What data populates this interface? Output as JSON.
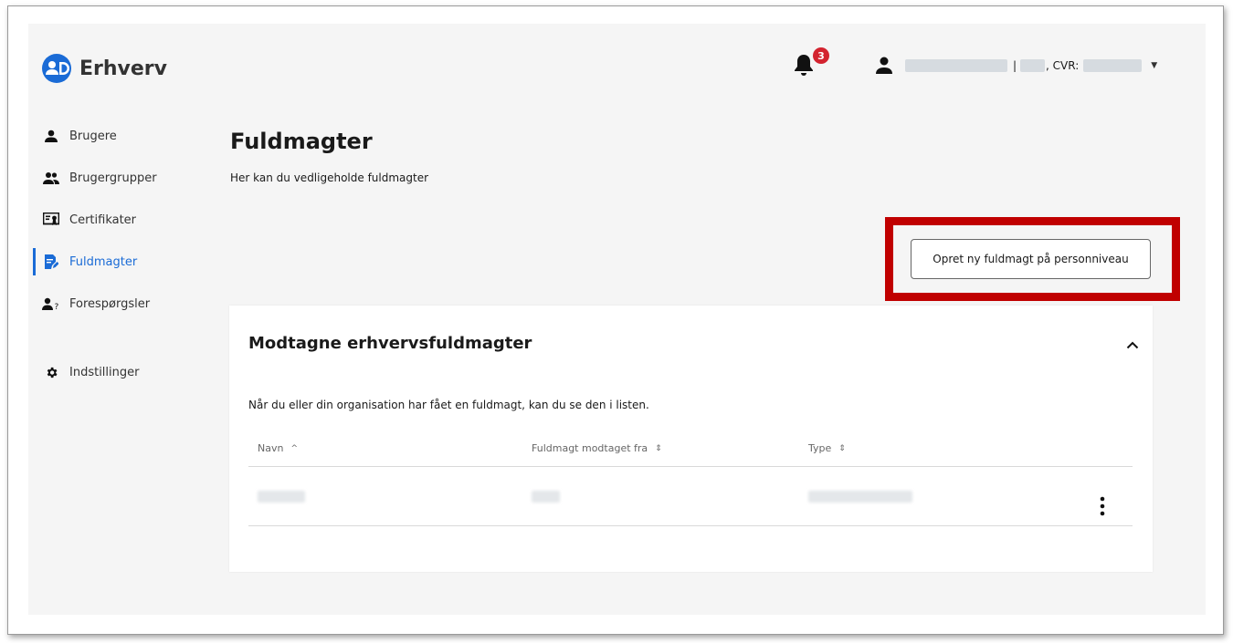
{
  "brand": {
    "name": "Erhverv",
    "logo_color": "#1a6bd6"
  },
  "header": {
    "notification_count": "3",
    "user_separator": "|",
    "cvr_label": ", CVR:"
  },
  "nav": {
    "items": [
      {
        "label": "Brugere",
        "icon": "user-icon"
      },
      {
        "label": "Brugergrupper",
        "icon": "users-icon"
      },
      {
        "label": "Certifikater",
        "icon": "certificate-icon"
      },
      {
        "label": "Fuldmagter",
        "icon": "document-edit-icon",
        "active": true
      },
      {
        "label": "Forespørgsler",
        "icon": "user-question-icon"
      },
      {
        "label": "Indstillinger",
        "icon": "gear-icon"
      }
    ],
    "active_color": "#1a6bd6"
  },
  "main": {
    "title": "Fuldmagter",
    "subtitle": "Her kan du vedligeholde fuldmagter",
    "create_button_label": "Opret ny fuldmagt på personniveau",
    "highlight_color": "#c00000"
  },
  "card": {
    "title": "Modtagne erhvervsfuldmagter",
    "description": "Når du eller din organisation har fået en fuldmagt, kan du se den i listen.",
    "columns": [
      "Navn",
      "Fuldmagt modtaget fra",
      "Type"
    ]
  },
  "accent_badge_color": "#d3232f"
}
